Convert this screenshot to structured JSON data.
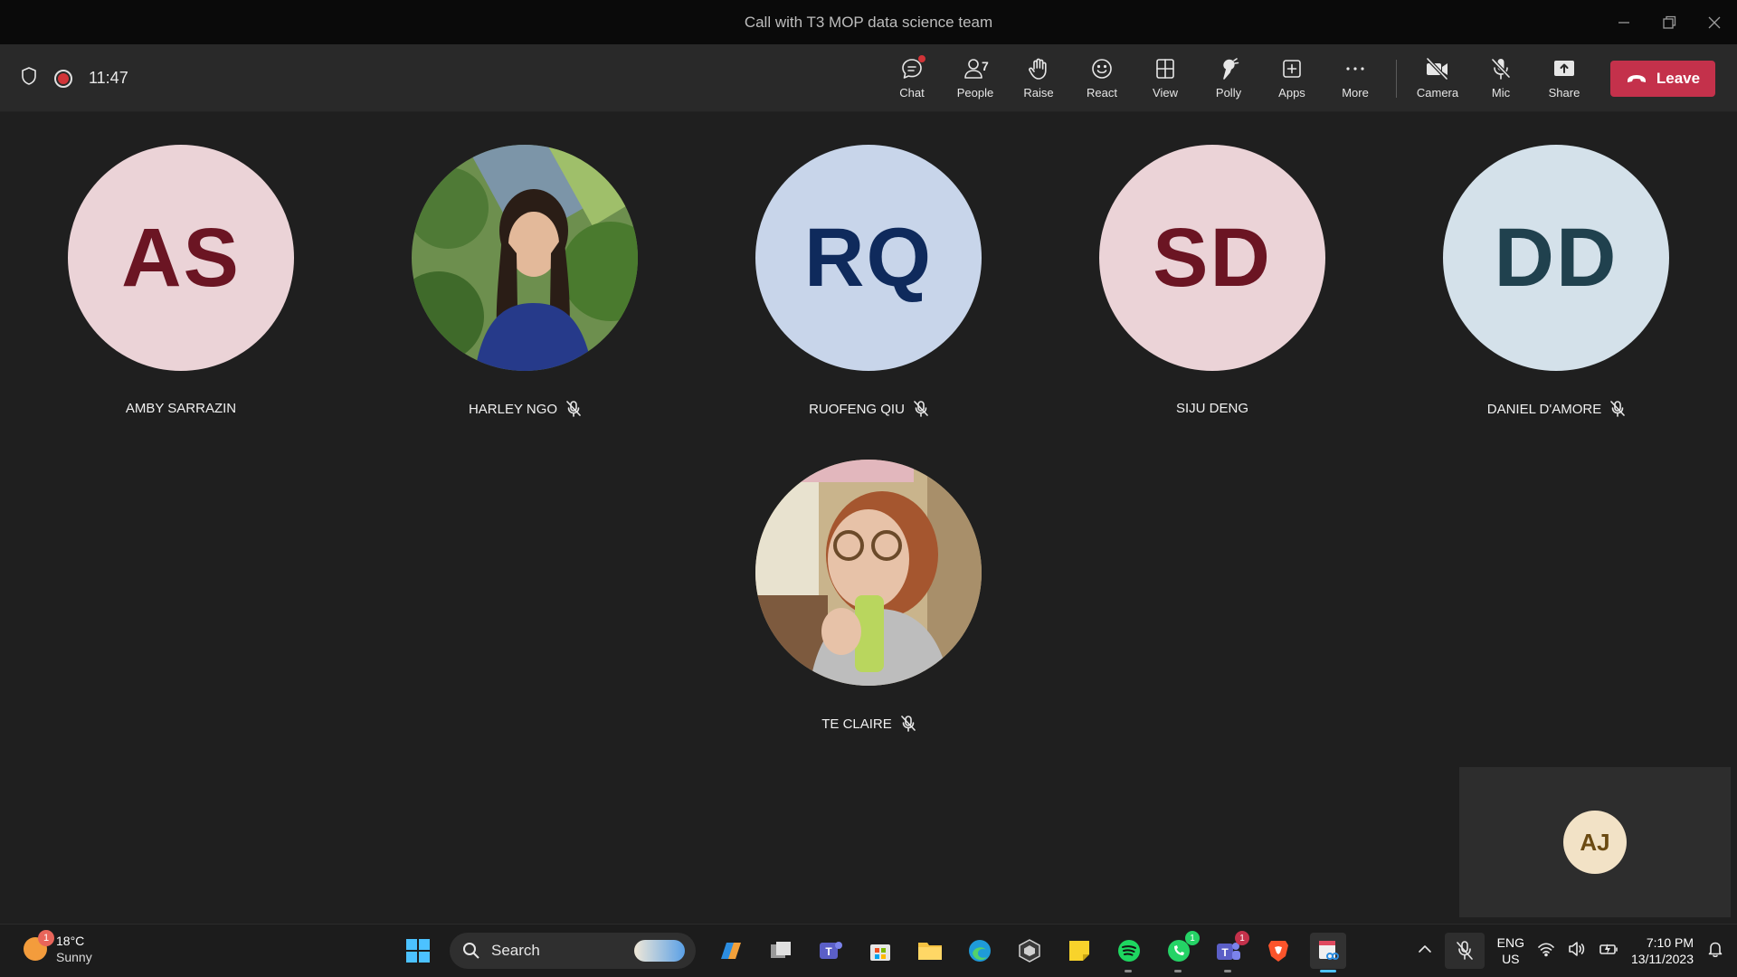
{
  "window": {
    "title": "Call with T3 MOP data science team"
  },
  "meeting": {
    "elapsed": "11:47"
  },
  "toolbar": {
    "chat": "Chat",
    "people": "People",
    "people_count": "7",
    "raise": "Raise",
    "react": "React",
    "view": "View",
    "polly": "Polly",
    "apps": "Apps",
    "more": "More",
    "camera": "Camera",
    "mic": "Mic",
    "share": "Share",
    "leave": "Leave"
  },
  "participants": [
    {
      "initials": "AS",
      "name": "AMBY SARRAZIN",
      "muted": false,
      "bg": "#ebd3d7",
      "fg": "#6b1523"
    },
    {
      "initials": "",
      "name": "HARLEY NGO",
      "muted": true,
      "photo": "harley-ngo-photo"
    },
    {
      "initials": "RQ",
      "name": "RUOFENG QIU",
      "muted": true,
      "bg": "#c8d5ea",
      "fg": "#0f2a5c"
    },
    {
      "initials": "SD",
      "name": "SIJU DENG",
      "muted": false,
      "bg": "#ebd3d7",
      "fg": "#6b1523"
    },
    {
      "initials": "DD",
      "name": "DANIEL D'AMORE",
      "muted": true,
      "bg": "#d4e1ea",
      "fg": "#20414e"
    },
    {
      "initials": "",
      "name": "TE CLAIRE",
      "muted": true,
      "photo": "te-claire-photo"
    }
  ],
  "self_view": {
    "initials": "AJ",
    "bg": "#f2e2c6",
    "fg": "#6b4a12"
  },
  "taskbar": {
    "weather_temp": "18°C",
    "weather_desc": "Sunny",
    "weather_badge": "1",
    "search_placeholder": "Search",
    "whatsapp_badge": "1",
    "teams_badge": "1",
    "lang": "ENG",
    "region": "US",
    "time": "7:10 PM",
    "date": "13/11/2023"
  },
  "colors": {
    "leave": "#c4314b",
    "recording": "#d13438",
    "active_app": "#4cc2ff"
  }
}
